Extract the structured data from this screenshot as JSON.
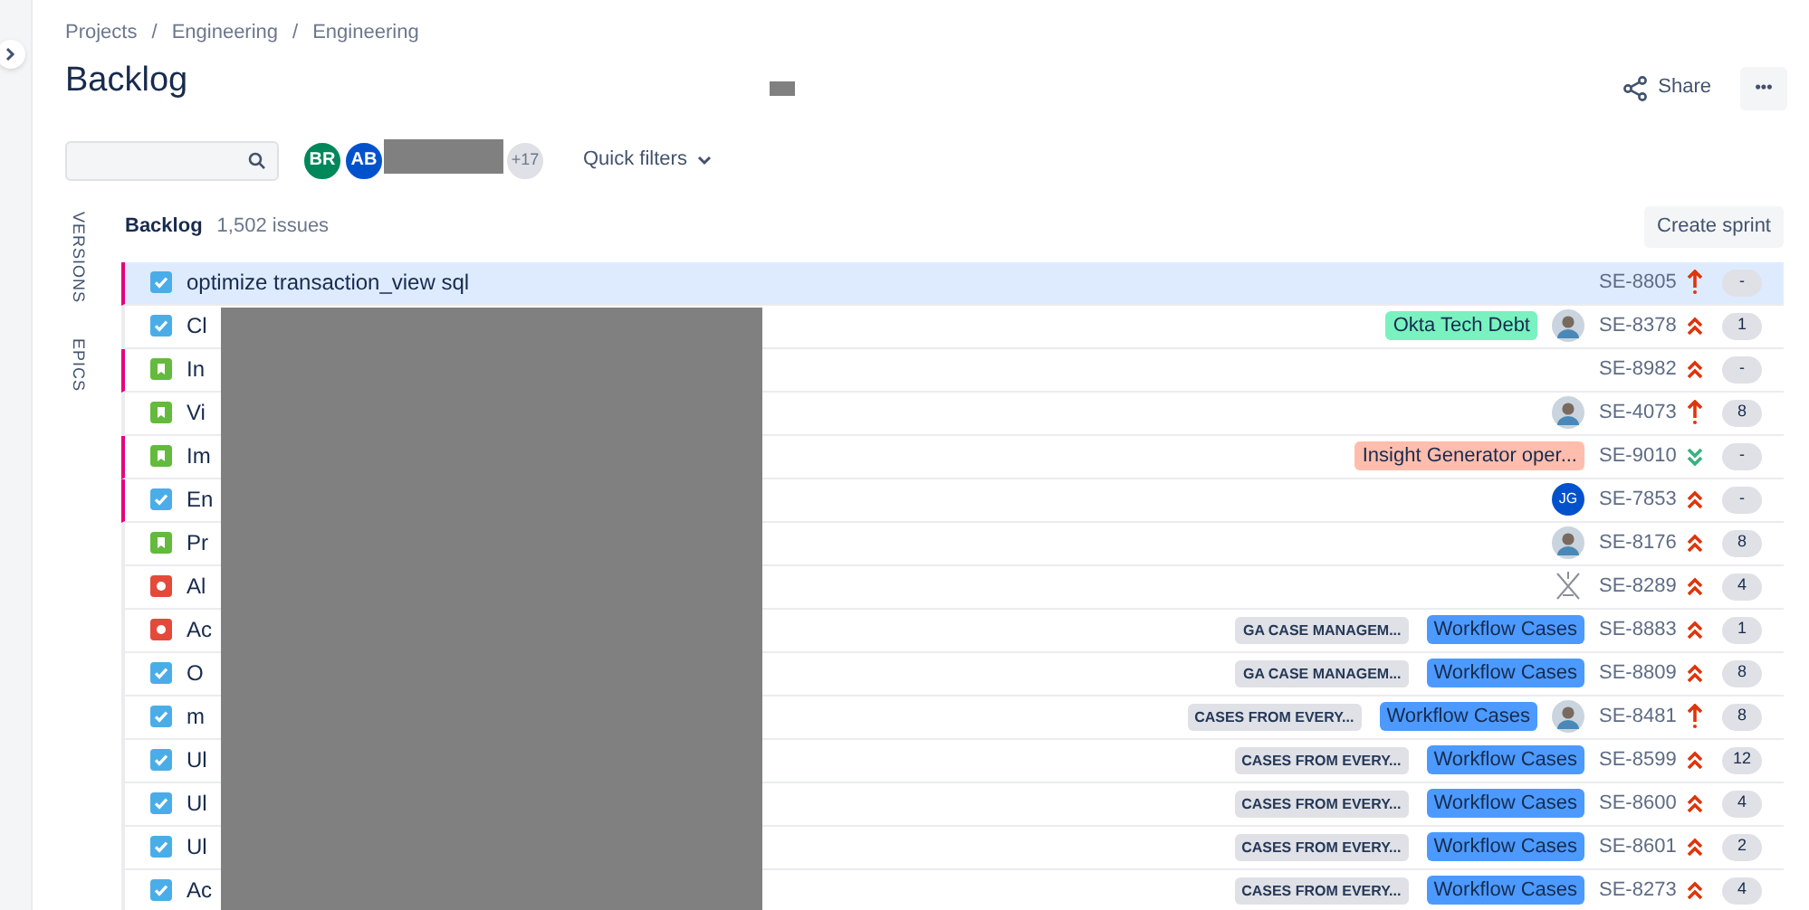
{
  "breadcrumbs": [
    "Projects",
    "Engineering",
    "Engineering"
  ],
  "breadcrumb_separator": "/",
  "title": "Backlog",
  "header_actions": {
    "share": "Share",
    "more": "•••"
  },
  "people": [
    {
      "initials": "BR",
      "color": "#00875a"
    },
    {
      "initials": "AB",
      "color": "#0052cc"
    }
  ],
  "people_more": "+17",
  "quick_filters": "Quick filters",
  "side_tabs": [
    "VERSIONS",
    "EPICS"
  ],
  "backlog": {
    "name": "Backlog",
    "count": "1,502 issues",
    "create_sprint": "Create sprint"
  },
  "issues": [
    {
      "kind": "task",
      "summary": "optimize transaction_view sql",
      "flagged": true,
      "selected": true,
      "key": "SE-8805",
      "priority": {
        "kind": "highest"
      },
      "estimate": "-"
    },
    {
      "kind": "task",
      "summary": "Cl",
      "flagged": false,
      "selected": false,
      "epic": {
        "name": "Okta Tech Debt",
        "color": "#79f2c0"
      },
      "assignee": {
        "kind": "photo"
      },
      "key": "SE-8378",
      "priority": {
        "kind": "high"
      },
      "estimate": "1"
    },
    {
      "kind": "story",
      "summary": "In",
      "flagged": true,
      "selected": false,
      "key": "SE-8982",
      "priority": {
        "kind": "high"
      },
      "estimate": "-"
    },
    {
      "kind": "story",
      "summary": "Vi",
      "flagged": false,
      "selected": false,
      "assignee": {
        "kind": "photo"
      },
      "key": "SE-4073",
      "priority": {
        "kind": "highest"
      },
      "estimate": "8"
    },
    {
      "kind": "story",
      "summary": "Im",
      "flagged": true,
      "selected": false,
      "epic": {
        "name": "Insight Generator oper...",
        "color": "#ffbdad"
      },
      "key": "SE-9010",
      "priority": {
        "kind": "low"
      },
      "estimate": "-"
    },
    {
      "kind": "task",
      "summary": "En",
      "flagged": true,
      "selected": false,
      "assignee": {
        "kind": "initials",
        "initials": "JG"
      },
      "key": "SE-7853",
      "priority": {
        "kind": "high"
      },
      "estimate": "-"
    },
    {
      "kind": "story",
      "summary": "Pr",
      "flagged": false,
      "selected": false,
      "assignee": {
        "kind": "photo"
      },
      "key": "SE-8176",
      "priority": {
        "kind": "high"
      },
      "estimate": "8"
    },
    {
      "kind": "bug",
      "summary": "Al",
      "flagged": false,
      "selected": false,
      "assignee": {
        "kind": "logo"
      },
      "key": "SE-8289",
      "priority": {
        "kind": "high"
      },
      "estimate": "4"
    },
    {
      "kind": "bug",
      "summary": "Ac",
      "flagged": false,
      "selected": false,
      "version": "GA CASE MANAGEM...",
      "epic": {
        "name": "Workflow Cases",
        "color": "#4c9aff"
      },
      "key": "SE-8883",
      "priority": {
        "kind": "high"
      },
      "estimate": "1"
    },
    {
      "kind": "task",
      "summary": "O",
      "flagged": false,
      "selected": false,
      "version": "GA CASE MANAGEM...",
      "epic": {
        "name": "Workflow Cases",
        "color": "#4c9aff"
      },
      "key": "SE-8809",
      "priority": {
        "kind": "high"
      },
      "estimate": "8"
    },
    {
      "kind": "task",
      "summary": "m",
      "flagged": false,
      "selected": false,
      "version": "CASES FROM EVERY...",
      "epic": {
        "name": "Workflow Cases",
        "color": "#4c9aff"
      },
      "assignee": {
        "kind": "photo"
      },
      "key": "SE-8481",
      "priority": {
        "kind": "highest"
      },
      "estimate": "8"
    },
    {
      "kind": "task",
      "summary": "Ul",
      "flagged": false,
      "selected": false,
      "version": "CASES FROM EVERY...",
      "epic": {
        "name": "Workflow Cases",
        "color": "#4c9aff"
      },
      "key": "SE-8599",
      "priority": {
        "kind": "high"
      },
      "estimate": "12"
    },
    {
      "kind": "task",
      "summary": "Ul",
      "flagged": false,
      "selected": false,
      "version": "CASES FROM EVERY...",
      "epic": {
        "name": "Workflow Cases",
        "color": "#4c9aff"
      },
      "key": "SE-8600",
      "priority": {
        "kind": "high"
      },
      "estimate": "4"
    },
    {
      "kind": "task",
      "summary": "Ul",
      "flagged": false,
      "selected": false,
      "version": "CASES FROM EVERY...",
      "epic": {
        "name": "Workflow Cases",
        "color": "#4c9aff"
      },
      "key": "SE-8601",
      "priority": {
        "kind": "high"
      },
      "estimate": "2"
    },
    {
      "kind": "task",
      "summary": "Ac",
      "flagged": false,
      "selected": false,
      "version": "CASES FROM EVERY...",
      "epic": {
        "name": "Workflow Cases",
        "color": "#4c9aff"
      },
      "key": "SE-8273",
      "priority": {
        "kind": "high"
      },
      "estimate": "4"
    }
  ]
}
